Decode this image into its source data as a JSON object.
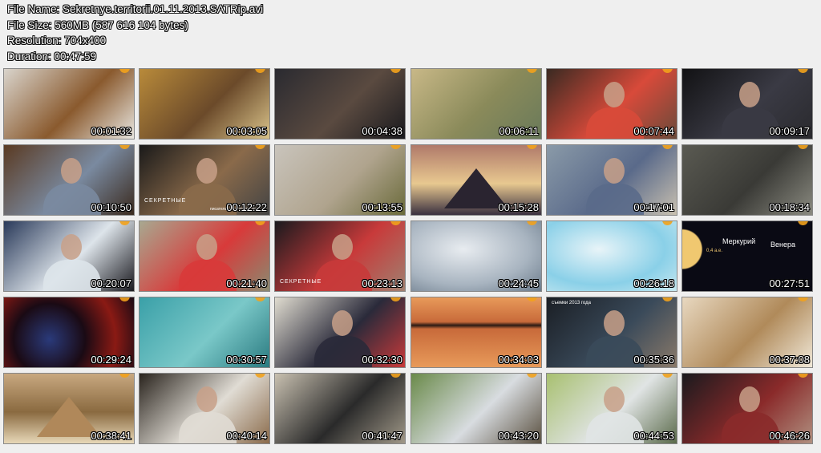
{
  "file_info": {
    "name_line": "File Name: Sekretnye.territorii.01.11.2013.SATRip.avi",
    "size_line": "File Size: 560MB (587 616 104 bytes)",
    "resolution_line": "Resolution: 704x400",
    "duration_line": "Duration: 00:47:59"
  },
  "thumbnails": [
    {
      "timestamp": "00:01:32",
      "scene": "building-entrance",
      "colors": [
        "#d9d4cc",
        "#8a5a2e",
        "#e8e6e0"
      ]
    },
    {
      "timestamp": "00:03:05",
      "scene": "historical-painting",
      "colors": [
        "#b88a3a",
        "#6b4a2a",
        "#d9c38a"
      ]
    },
    {
      "timestamp": "00:04:38",
      "scene": "dark-portraits",
      "colors": [
        "#2a2a30",
        "#5a4a40",
        "#1a1a1e"
      ]
    },
    {
      "timestamp": "00:06:11",
      "scene": "old-map",
      "colors": [
        "#c8b887",
        "#8a8a5a",
        "#6a7a5a"
      ]
    },
    {
      "timestamp": "00:07:44",
      "scene": "woman-interview",
      "colors": [
        "#3a2a22",
        "#d84a3a",
        "#6a4a3a"
      ]
    },
    {
      "timestamp": "00:09:17",
      "scene": "man-interview-dark",
      "colors": [
        "#121214",
        "#3a3a44",
        "#2a2a2e"
      ]
    },
    {
      "timestamp": "00:10:50",
      "scene": "man-bookshelf",
      "colors": [
        "#5a3a22",
        "#7a8aa0",
        "#3a2a1e"
      ]
    },
    {
      "timestamp": "00:12:22",
      "scene": "man-glasses-studio",
      "colors": [
        "#1a1a1a",
        "#8a6a4a",
        "#444"
      ]
    },
    {
      "timestamp": "00:13:55",
      "scene": "rock-formations",
      "colors": [
        "#c9c4bc",
        "#b0a48e",
        "#6a6a3a"
      ]
    },
    {
      "timestamp": "00:15:28",
      "scene": "pyramids-sunset",
      "colors": [
        "#b07a6a",
        "#3a3040",
        "#e8c890"
      ]
    },
    {
      "timestamp": "00:17:01",
      "scene": "man-office",
      "colors": [
        "#8a9aa8",
        "#5a6a8a",
        "#c8c0b0"
      ]
    },
    {
      "timestamp": "00:18:34",
      "scene": "ruins",
      "colors": [
        "#5a5a52",
        "#3a3a36",
        "#8a8a80"
      ]
    },
    {
      "timestamp": "00:20:07",
      "scene": "man-winter",
      "colors": [
        "#2a3a5a",
        "#dde4ea",
        "#1a1a20"
      ]
    },
    {
      "timestamp": "00:21:40",
      "scene": "man-rock-wall",
      "colors": [
        "#a8a890",
        "#d83a3a",
        "#8a8a70"
      ]
    },
    {
      "timestamp": "00:23:13",
      "scene": "man-studio-red",
      "colors": [
        "#1a1a1e",
        "#c83a3a",
        "#a08070"
      ]
    },
    {
      "timestamp": "00:24:45",
      "scene": "clouds",
      "colors": [
        "#a8b4c0",
        "#e8ecf0",
        "#6a7a8a"
      ]
    },
    {
      "timestamp": "00:26:18",
      "scene": "blue-sky-light",
      "colors": [
        "#8ad0e8",
        "#e8f4f8",
        "#c8e8f0"
      ]
    },
    {
      "timestamp": "00:27:51",
      "scene": "planets-space",
      "colors": [
        "#0a0a14",
        "#f0c870",
        "#d88a4a"
      ]
    },
    {
      "timestamp": "00:29:24",
      "scene": "planet-nebula",
      "colors": [
        "#8a1a14",
        "#2a3a7a",
        "#1a0a14"
      ]
    },
    {
      "timestamp": "00:30:57",
      "scene": "underwater",
      "colors": [
        "#3aa0a8",
        "#7ac8c8",
        "#2a7a80"
      ]
    },
    {
      "timestamp": "00:32:30",
      "scene": "man-tie-office",
      "colors": [
        "#e0dcd0",
        "#2a2a3a",
        "#c83a3a"
      ]
    },
    {
      "timestamp": "00:34:03",
      "scene": "red-field",
      "colors": [
        "#c86a3a",
        "#e89a5a",
        "#2a1a14"
      ]
    },
    {
      "timestamp": "00:35:36",
      "scene": "man-sweater",
      "colors": [
        "#1a1e24",
        "#3a4a5a",
        "#8a7a6a"
      ]
    },
    {
      "timestamp": "00:37:08",
      "scene": "pharaoh-statue",
      "colors": [
        "#e8d8c0",
        "#b08a5a",
        "#f0e8d8"
      ]
    },
    {
      "timestamp": "00:38:41",
      "scene": "pyramid-sphinx",
      "colors": [
        "#c8a880",
        "#e8d8b8",
        "#8a6a40"
      ]
    },
    {
      "timestamp": "00:40:14",
      "scene": "bearded-man",
      "colors": [
        "#2a241e",
        "#e0dcd4",
        "#8a6a4a"
      ]
    },
    {
      "timestamp": "00:41:47",
      "scene": "stone-doorway",
      "colors": [
        "#c8c0b0",
        "#2a2a2a",
        "#a09888"
      ]
    },
    {
      "timestamp": "00:43:20",
      "scene": "stone-idols-field",
      "colors": [
        "#6a8a4a",
        "#d8dce0",
        "#5a5040"
      ]
    },
    {
      "timestamp": "00:44:53",
      "scene": "man-pillar-field",
      "colors": [
        "#a8c070",
        "#e0e4e4",
        "#5a6a4a"
      ]
    },
    {
      "timestamp": "00:46:26",
      "scene": "old-man-dark",
      "colors": [
        "#1a1a1e",
        "#8a2a2a",
        "#b09080"
      ]
    }
  ],
  "overlays": {
    "sekretnye_logo_1": "СЕКРЕТНЫЕ",
    "sekretnye_logo_2": "СЕКРЕТНЫЕ",
    "credit_12": "писатель-путешественник",
    "mercury": "Меркурий",
    "venus": "Венера",
    "distance": "0,4 а.е.",
    "caption_35": "съемки 2013 года"
  }
}
